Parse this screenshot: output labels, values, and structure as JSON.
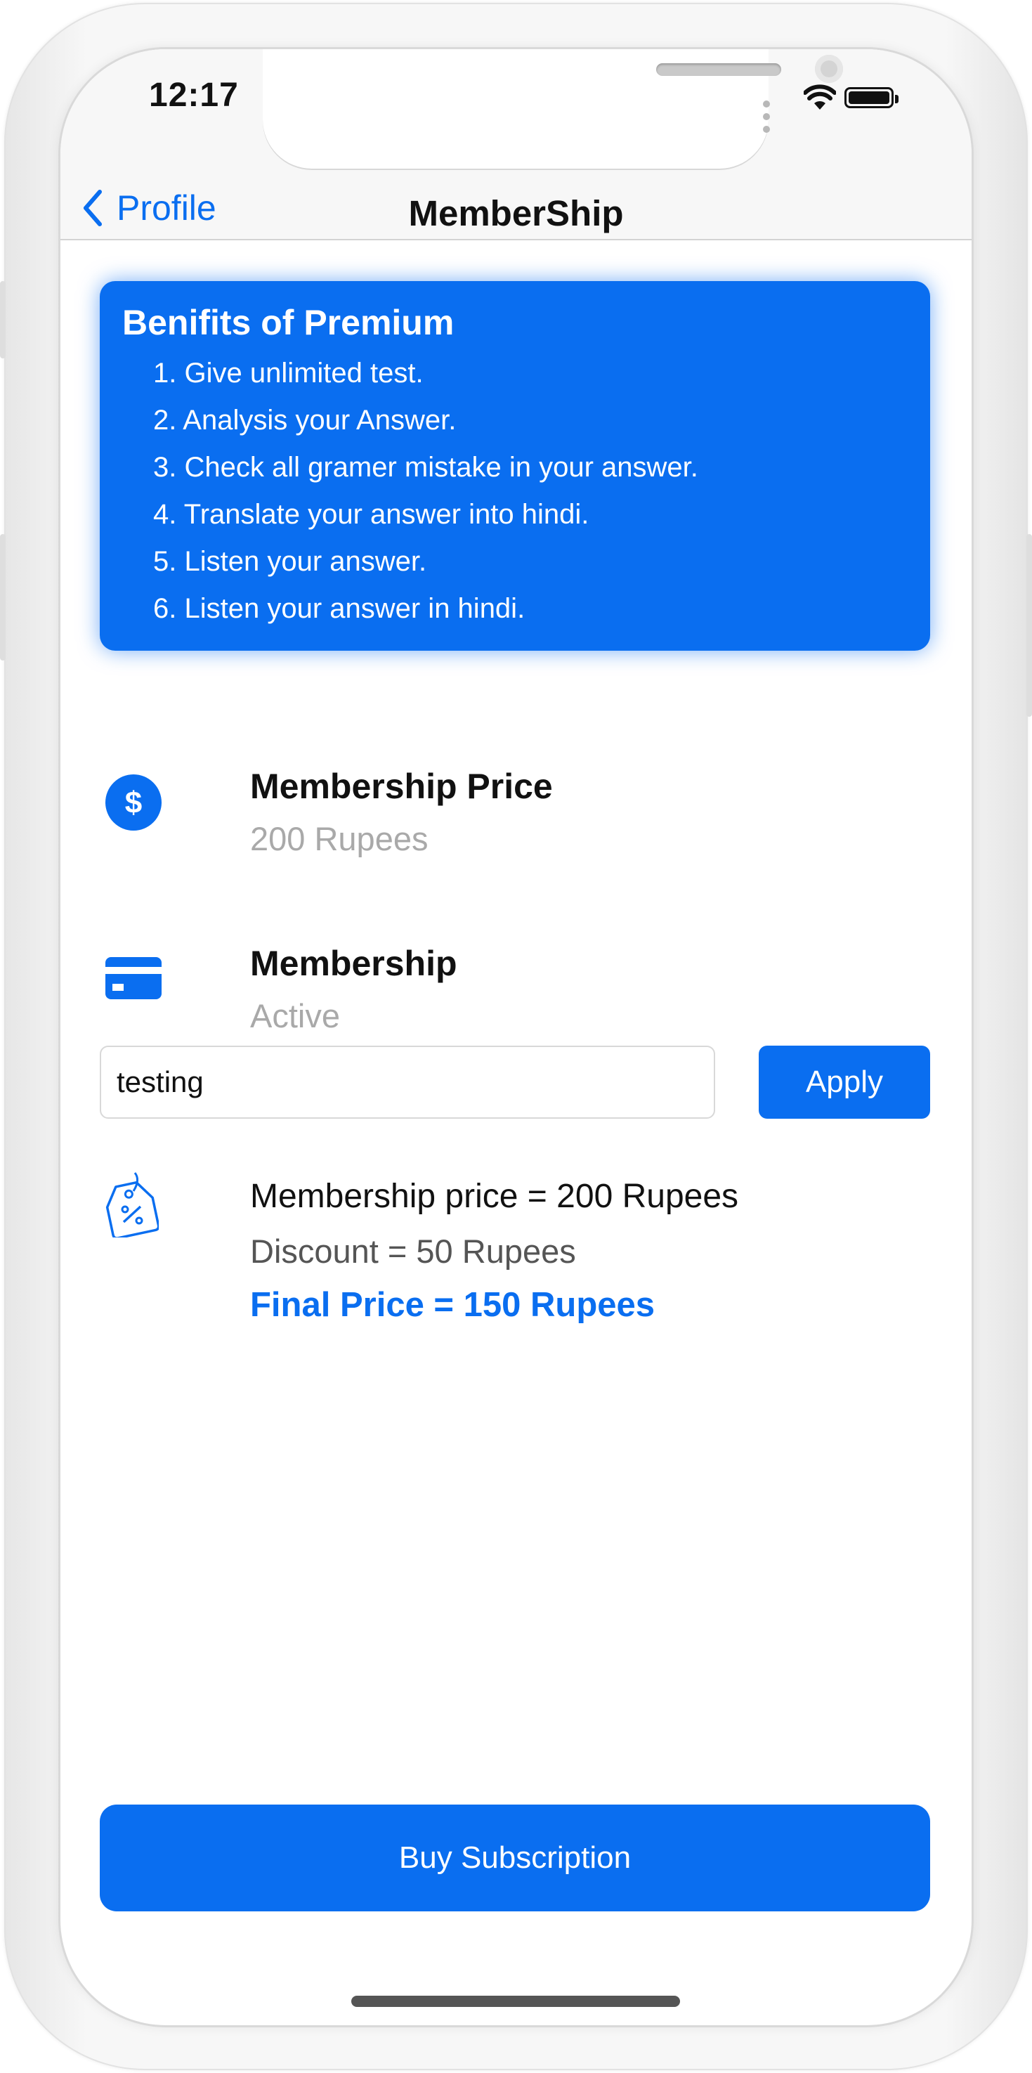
{
  "status_bar": {
    "time": "12:17"
  },
  "nav": {
    "back_label": "Profile",
    "title": "MemberShip"
  },
  "benefits": {
    "title": "Benifits of Premium",
    "items": [
      "1. Give unlimited test.",
      "2. Analysis your Answer.",
      "3. Check all gramer mistake in your answer.",
      "4. Translate your answer into hindi.",
      "5. Listen your answer.",
      "6. Listen your answer in hindi."
    ]
  },
  "membership_price": {
    "label": "Membership Price",
    "value": "200 Rupees",
    "icon": "dollar-icon"
  },
  "membership_status": {
    "label": "Membership",
    "value": "Active",
    "icon": "credit-card-icon"
  },
  "coupon": {
    "value": "testing",
    "apply_label": "Apply"
  },
  "pricing": {
    "icon": "discount-tag-icon",
    "membership_line": "Membership price = 200 Rupees",
    "discount_line": "Discount = 50 Rupees",
    "final_line": "Final Price = 150 Rupees"
  },
  "buy_button": {
    "label": "Buy Subscription"
  },
  "colors": {
    "accent": "#0A6EF0",
    "text": "#111111",
    "muted": "#A9A9A9"
  }
}
